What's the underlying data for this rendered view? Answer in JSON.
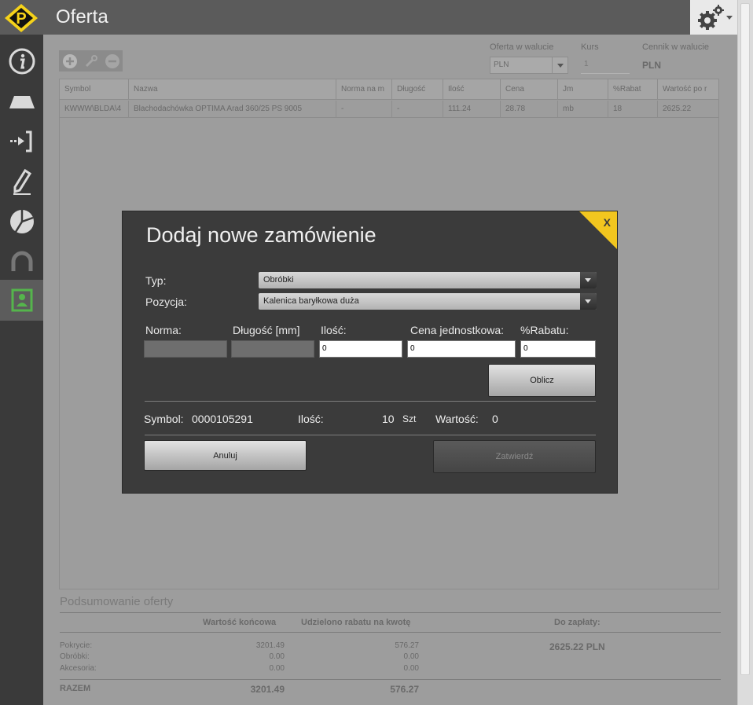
{
  "app": {
    "title": "Oferta"
  },
  "icons": {
    "logo": "logo-p-icon",
    "settings": "gear-icon",
    "sidebar": [
      "info-icon",
      "roof-icon",
      "import-icon",
      "edit-icon",
      "pie-chart-icon",
      "magnet-icon",
      "contact-icon"
    ]
  },
  "colors": {
    "accent_yellow": "#f2c61f",
    "active_green": "#55b54c",
    "sidebar_bg": "#3a3a3a"
  },
  "offer_header": {
    "currency_label": "Oferta w walucie",
    "currency_value": "PLN",
    "rate_label": "Kurs",
    "rate_value": "1",
    "pricelist_label": "Cennik w walucie",
    "pricelist_value": "PLN"
  },
  "table": {
    "headers": [
      "Symbol",
      "Nazwa",
      "Norma na m",
      "Długość",
      "Ilość",
      "Cena",
      "Jm",
      "%Rabat",
      "Wartość po r"
    ],
    "rows": [
      [
        "KWWW\\BLDA\\4",
        "Blachodachówka OPTIMA Arad 360/25 PS 9005",
        "-",
        "-",
        "111.24",
        "28.78",
        "mb",
        "18",
        "2625.22"
      ]
    ]
  },
  "summary": {
    "title": "Podsumowanie oferty",
    "col_final": "Wartość końcowa",
    "col_discount": "Udzielono rabatu na kwotę",
    "col_topay": "Do zapłaty:",
    "rows": [
      {
        "label": "Pokrycie:",
        "final": "3201.49",
        "discount": "576.27"
      },
      {
        "label": "Obróbki:",
        "final": "0.00",
        "discount": "0.00"
      },
      {
        "label": "Akcesoria:",
        "final": "0.00",
        "discount": "0.00"
      }
    ],
    "topay_value": "2625.22 PLN",
    "total_label": "RAZEM",
    "total_final": "3201.49",
    "total_discount": "576.27"
  },
  "modal": {
    "title": "Dodaj nowe zamówienie",
    "close_label": "X",
    "type_label": "Typ:",
    "type_value": "Obróbki",
    "position_label": "Pozycja:",
    "position_value": "Kalenica baryłkowa duża",
    "norma_label": "Norma:",
    "norma_value": "",
    "length_label": "Długość [mm]",
    "length_value": "",
    "qty_label": "Ilość:",
    "qty_value": "0",
    "price_label": "Cena jednostkowa:",
    "price_value": "0",
    "discount_label": "%Rabatu:",
    "discount_value": "0",
    "calc_button": "Oblicz",
    "symbol_label": "Symbol:",
    "symbol_value": "0000105291",
    "qty_info_label": "Ilość:",
    "qty_info_value": "10",
    "qty_info_unit": "Szt",
    "value_label": "Wartość:",
    "value_value": "0",
    "cancel_button": "Anuluj",
    "confirm_button": "Zatwierdź"
  }
}
